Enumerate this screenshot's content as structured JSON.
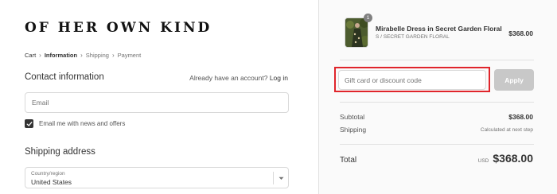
{
  "brand": {
    "logo_text": "OF HER OWN KIND"
  },
  "breadcrumb": [
    {
      "label": "Cart",
      "state": "link"
    },
    {
      "label": "Information",
      "state": "current"
    },
    {
      "label": "Shipping",
      "state": "muted"
    },
    {
      "label": "Payment",
      "state": "muted"
    }
  ],
  "breadcrumb_separator": "›",
  "contact": {
    "title": "Contact information",
    "account_prompt": "Already have an account?",
    "login_label": "Log in",
    "email_placeholder": "Email",
    "email_value": "",
    "newsletter_label": "Email me with news and offers",
    "newsletter_checked": true
  },
  "shipping": {
    "title": "Shipping address",
    "country_label": "Country/region",
    "country_value": "United States"
  },
  "order": {
    "item": {
      "name": "Mirabelle Dress in Secret Garden Floral",
      "variant": "S / SECRET GARDEN FLORAL",
      "price": "$368.00",
      "quantity": "1"
    },
    "discount_placeholder": "Gift card or discount code",
    "discount_value": "",
    "apply_label": "Apply",
    "subtotal_label": "Subtotal",
    "subtotal_value": "$368.00",
    "shipping_label": "Shipping",
    "shipping_value": "Calculated at next step",
    "total_label": "Total",
    "total_currency": "USD",
    "total_value": "$368.00"
  },
  "colors": {
    "highlight": "#e0252b",
    "apply_button": "#c8c8c8",
    "sidebar_bg": "#fafafa"
  },
  "icons": {
    "select_chevron": "chevron-down-icon",
    "checkbox_check": "check-icon"
  }
}
